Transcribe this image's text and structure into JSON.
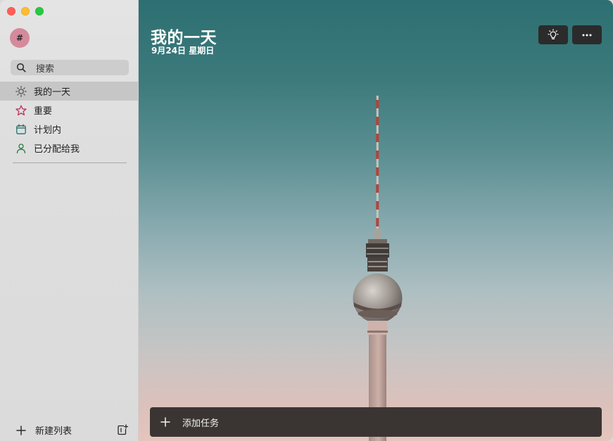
{
  "window": {
    "traffic_lights": [
      "close",
      "minimize",
      "maximize"
    ]
  },
  "sidebar": {
    "avatar_text": "#",
    "search": {
      "placeholder": "搜索",
      "icon": "search-icon"
    },
    "items": [
      {
        "label": "我的一天",
        "icon": "sun-icon",
        "active": true,
        "color": "#555555"
      },
      {
        "label": "重要",
        "icon": "star-icon",
        "active": false,
        "color": "#b8325a"
      },
      {
        "label": "计划内",
        "icon": "calendar-icon",
        "active": false,
        "color": "#1f6f6a"
      },
      {
        "label": "已分配给我",
        "icon": "person-icon",
        "active": false,
        "color": "#2d7a4a"
      }
    ],
    "new_list_label": "新建列表"
  },
  "main": {
    "title": "我的一天",
    "subtitle": "9月24日 星期日",
    "toolbar": {
      "suggest_icon": "lightbulb-icon",
      "more_icon": "more-icon"
    },
    "add_task_label": "添加任务"
  }
}
